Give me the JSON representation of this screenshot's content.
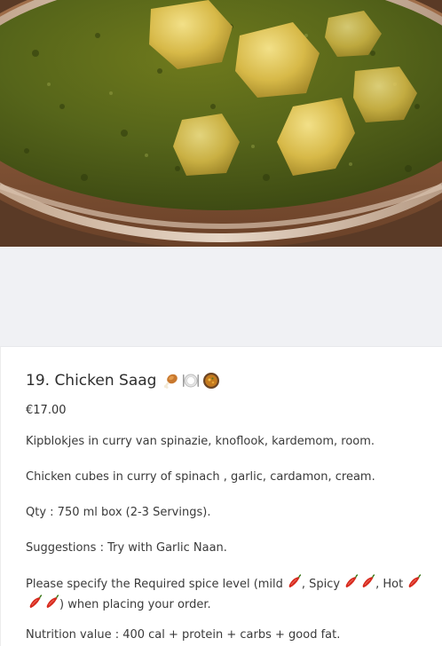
{
  "item": {
    "title": "19. Chicken Saag",
    "title_icons": [
      "chicken-leg-icon",
      "plate-cutlery-icon",
      "curry-bowl-icon"
    ],
    "price": "€17.00",
    "description_nl": "Kipblokjes in curry van spinazie, knoflook, kardemom, room.",
    "description_en": "Chicken cubes in curry of spinach , garlic, cardamon, cream.",
    "quantity": "Qty : 750 ml box (2-3 Servings).",
    "suggestions": "Suggestions : Try with Garlic Naan.",
    "spice": {
      "intro": "Please specify the Required spice level (mild",
      "spicy_label": ", Spicy",
      "hot_label": ", Hot",
      "outro": ") when placing your order.",
      "pepper_icon": "chili-pepper-icon"
    },
    "nutrition": "Nutrition value : 400 cal + protein + carbs + good fat."
  },
  "colors": {
    "divider_band": "#f0f1f4",
    "text": "#333333",
    "pepper": "#d62a1e"
  }
}
